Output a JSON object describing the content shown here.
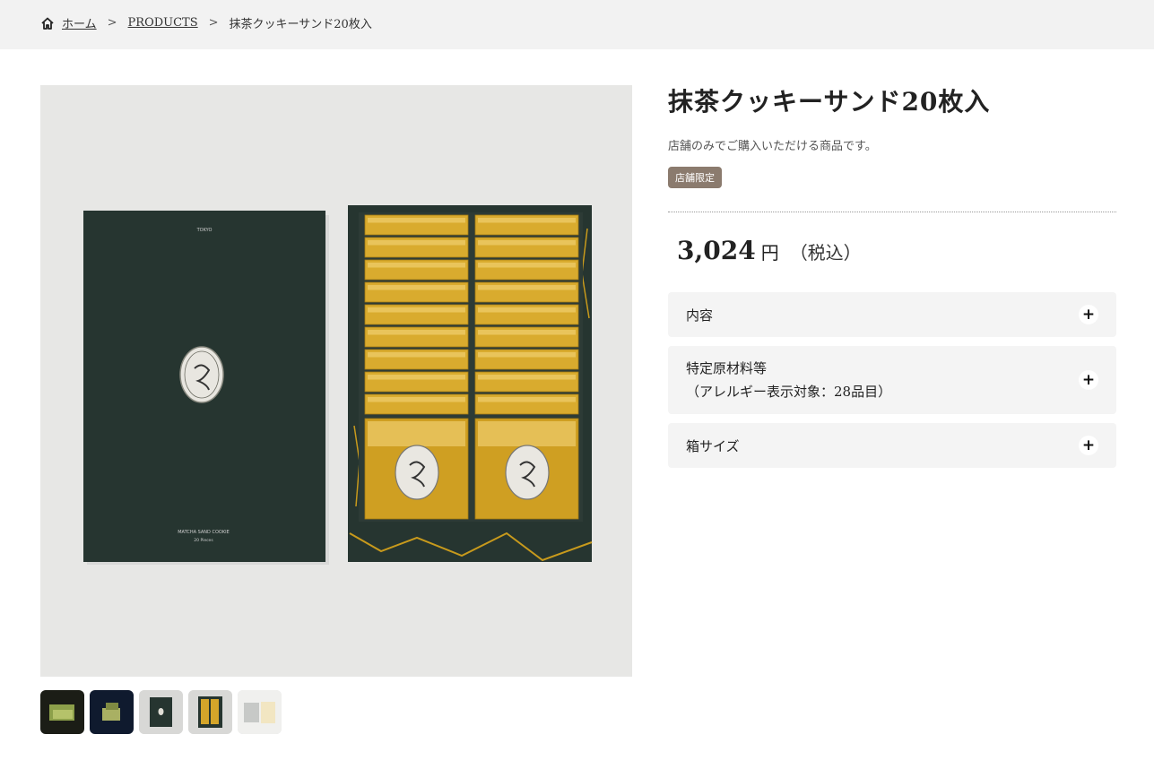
{
  "breadcrumb": {
    "home": "ホーム",
    "separator": ">",
    "products": "PRODUCTS",
    "current": "抹茶クッキーサンド20枚入"
  },
  "product": {
    "title": "抹茶クッキーサンド20枚入",
    "description": "店舗のみでご購入いただける商品です。",
    "badge": "店舗限定",
    "price": "3,024",
    "currency": "円",
    "tax_note": "（税込）"
  },
  "accordion": [
    {
      "label_line1": "内容",
      "label_line2": ""
    },
    {
      "label_line1": "特定原材料等",
      "label_line2": "（アレルギー表示対象：28品目）"
    },
    {
      "label_line1": "箱サイズ",
      "label_line2": ""
    }
  ],
  "icons": {
    "home": "home-icon",
    "plus": "plus-icon"
  },
  "gallery": {
    "thumbnail_count": 5
  },
  "colors": {
    "badge_bg": "#8b7b6e",
    "box_green": "#263530",
    "gold": "#c89a1c"
  }
}
